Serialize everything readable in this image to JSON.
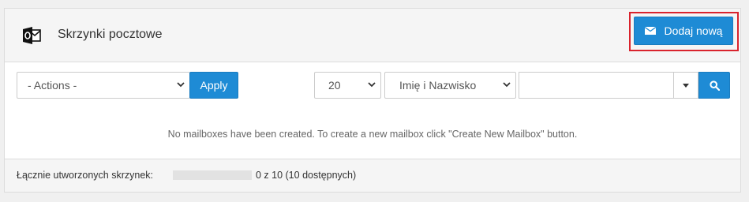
{
  "header": {
    "title": "Skrzynki pocztowe",
    "add_button_label": "Dodaj nową",
    "icons": {
      "app": "outlook-icon",
      "add": "envelope-icon"
    }
  },
  "toolbar": {
    "actions_select": "- Actions -",
    "apply_label": "Apply",
    "per_page_select": "20",
    "sort_select": "Imię i Nazwisko",
    "search_value": "",
    "icons": {
      "search": "search-icon",
      "caret": "caret-down-icon"
    }
  },
  "content": {
    "empty_message": "No mailboxes have been created. To create a new mailbox click \"Create New Mailbox\" button."
  },
  "footer": {
    "label": "Łącznie utworzonych skrzynek:",
    "count_text": "0 z 10 (10 dostępnych)",
    "usage_fraction": 0
  },
  "colors": {
    "primary": "#1e8bd5",
    "highlight": "#d9232d"
  }
}
